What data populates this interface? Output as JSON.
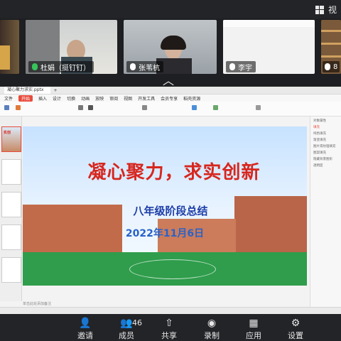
{
  "top_bar": {
    "view_label": "视"
  },
  "participants": [
    {
      "name": "杜娟（挺钉钉）"
    },
    {
      "name": "张苇杭"
    },
    {
      "name": "李宇"
    },
    {
      "name": "8"
    }
  ],
  "app": {
    "doc_tab": "凝心聚力求实.pptx",
    "menu": [
      "文件",
      "开始",
      "插入",
      "设计",
      "切换",
      "动画",
      "放映",
      "审阅",
      "视图",
      "开发工具",
      "会员专享",
      "稻壳资源"
    ],
    "menu_active": "开始",
    "notes_placeholder": "单击此处添加备注",
    "right_panel": [
      "对象属性",
      "填充",
      "纯色填充",
      "渐变填充",
      "图片或纹理填充",
      "图案填充",
      "隐藏背景图形",
      "透明度"
    ]
  },
  "slide": {
    "title": "凝心聚力，求实创新",
    "subtitle": "八年级阶段总结",
    "date": "2022年11月6日"
  },
  "thumb_first": "实创",
  "bottom_bar": {
    "participant_count": "46",
    "buttons": [
      {
        "label": "邀请"
      },
      {
        "label": "成员"
      },
      {
        "label": "共享"
      },
      {
        "label": "录制"
      },
      {
        "label": "应用"
      },
      {
        "label": "设置"
      }
    ]
  },
  "colors": {
    "title_red": "#d7261e",
    "subtitle_blue": "#1d3ea8",
    "bar_bg": "#232428"
  }
}
